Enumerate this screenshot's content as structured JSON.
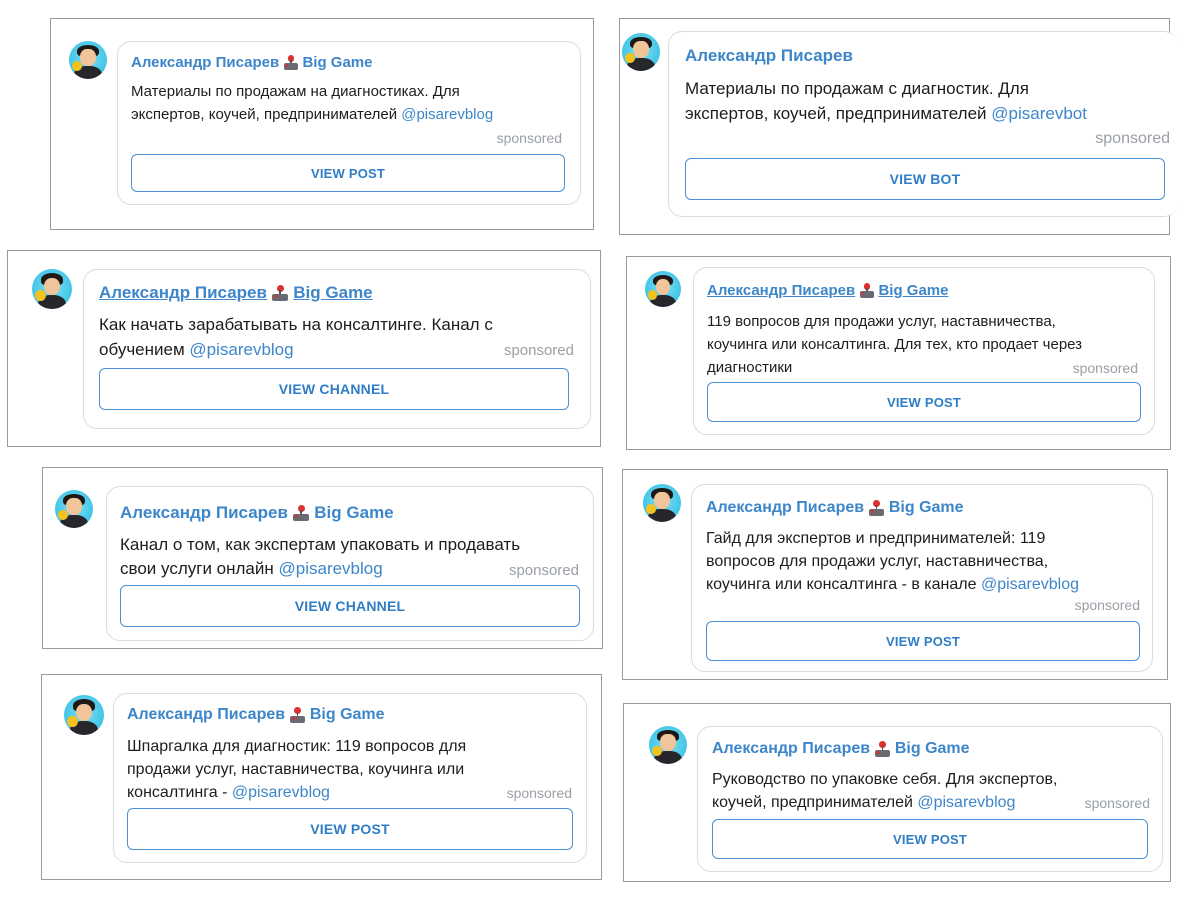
{
  "ads": [
    {
      "author": "Александр Писарев",
      "channel": "Big Game",
      "text": "Материалы по продажам на диагностиках. Для\nэкспертов, коучей, предпринимателей ",
      "handle": "@pisarevblog",
      "sponsored": "sponsored",
      "button": "VIEW POST"
    },
    {
      "author": "Александр Писарев",
      "channel": "",
      "text": "Материалы по продажам с диагностик. Для\nэкспертов, коучей, предпринимателей ",
      "handle": "@pisarevbot",
      "sponsored": "sponsored",
      "button": "VIEW BOT"
    },
    {
      "author": "Александр Писарев",
      "channel": "Big Game",
      "text": "Как начать зарабатывать на консалтинге. Канал с\nобучением ",
      "handle": "@pisarevblog",
      "sponsored": "sponsored",
      "button": "VIEW CHANNEL"
    },
    {
      "author": "Александр Писарев",
      "channel": "Big Game",
      "text": "119 вопросов для продажи услуг, наставничества,\nкоучинга или консалтинга. Для тех, кто продает через\nдиагностики",
      "handle": "",
      "sponsored": "sponsored",
      "button": "VIEW POST"
    },
    {
      "author": "Александр Писарев",
      "channel": "Big Game",
      "text": "Канал о том, как экспертам упаковать и продавать\nсвои услуги онлайн ",
      "handle": "@pisarevblog",
      "sponsored": "sponsored",
      "button": "VIEW CHANNEL"
    },
    {
      "author": "Александр Писарев",
      "channel": "Big Game",
      "text": "Гайд для экспертов и предпринимателей: 119\nвопросов для продажи услуг, наставничества,\nкоучинга или консалтинга - в канале ",
      "handle": "@pisarevblog",
      "sponsored": "sponsored",
      "button": "VIEW POST"
    },
    {
      "author": "Александр Писарев",
      "channel": "Big Game",
      "text": "Шпаргалка для диагностик: 119 вопросов для\nпродажи услуг, наставничества, коучинга или\nконсалтинга - ",
      "handle": "@pisarevblog",
      "sponsored": "sponsored",
      "button": "VIEW POST"
    },
    {
      "author": "Александр Писарев",
      "channel": "Big Game",
      "text": "Руководство по упаковке себя. Для экспертов,\nкоучей, предпринимателей ",
      "handle": "@pisarevblog",
      "sponsored": "sponsored",
      "button": "VIEW POST"
    }
  ],
  "colors": {
    "accent": "#3d86c9",
    "button_border": "#4a90d6",
    "sponsored": "#9aa0a6",
    "avatar_bg": "#44c6e8"
  },
  "icons": {
    "channel_emoji": "joystick-icon"
  }
}
